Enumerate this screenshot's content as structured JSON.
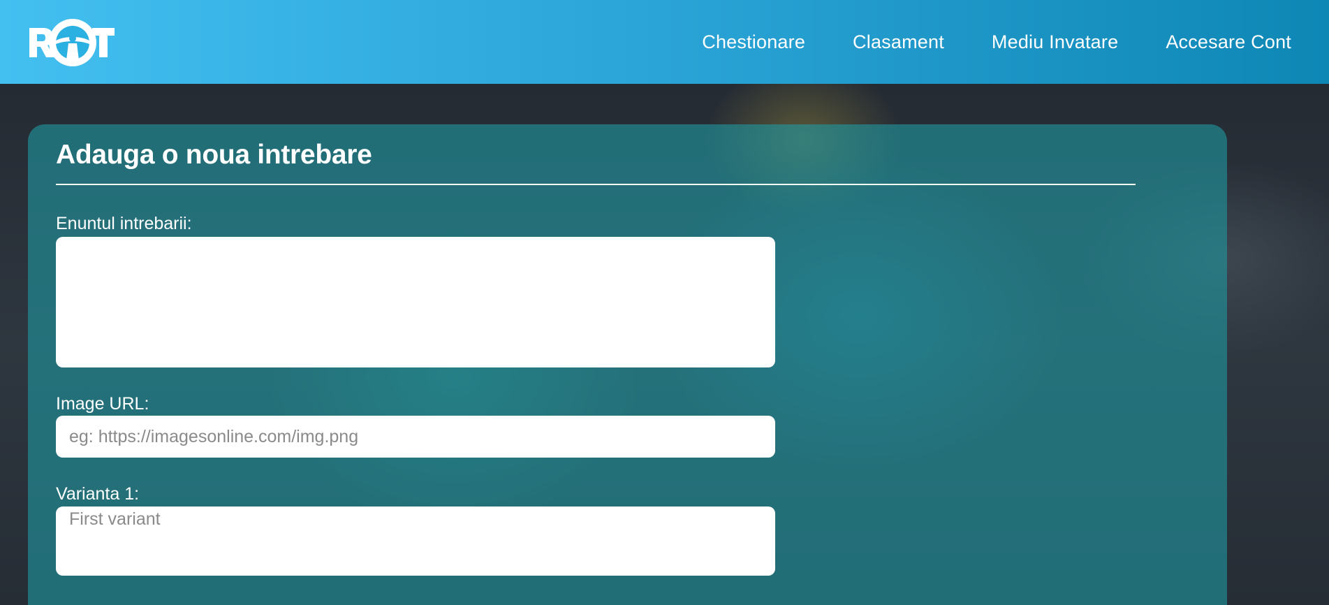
{
  "header": {
    "logo_text": "ROT",
    "nav": [
      {
        "label": "Chestionare"
      },
      {
        "label": "Clasament"
      },
      {
        "label": "Mediu Invatare"
      },
      {
        "label": "Accesare Cont"
      }
    ]
  },
  "form": {
    "title": "Adauga o noua intrebare",
    "question": {
      "label": "Enuntul intrebarii:",
      "value": "",
      "placeholder": ""
    },
    "image_url": {
      "label": "Image URL:",
      "value": "",
      "placeholder": "eg: https://imagesonline.com/img.png"
    },
    "variant1": {
      "label": "Varianta 1:",
      "value": "",
      "placeholder": "First variant"
    }
  },
  "colors": {
    "header_start": "#43bff0",
    "header_end": "#0e87b5",
    "card": "#2096a0",
    "background": "#2b3038"
  }
}
